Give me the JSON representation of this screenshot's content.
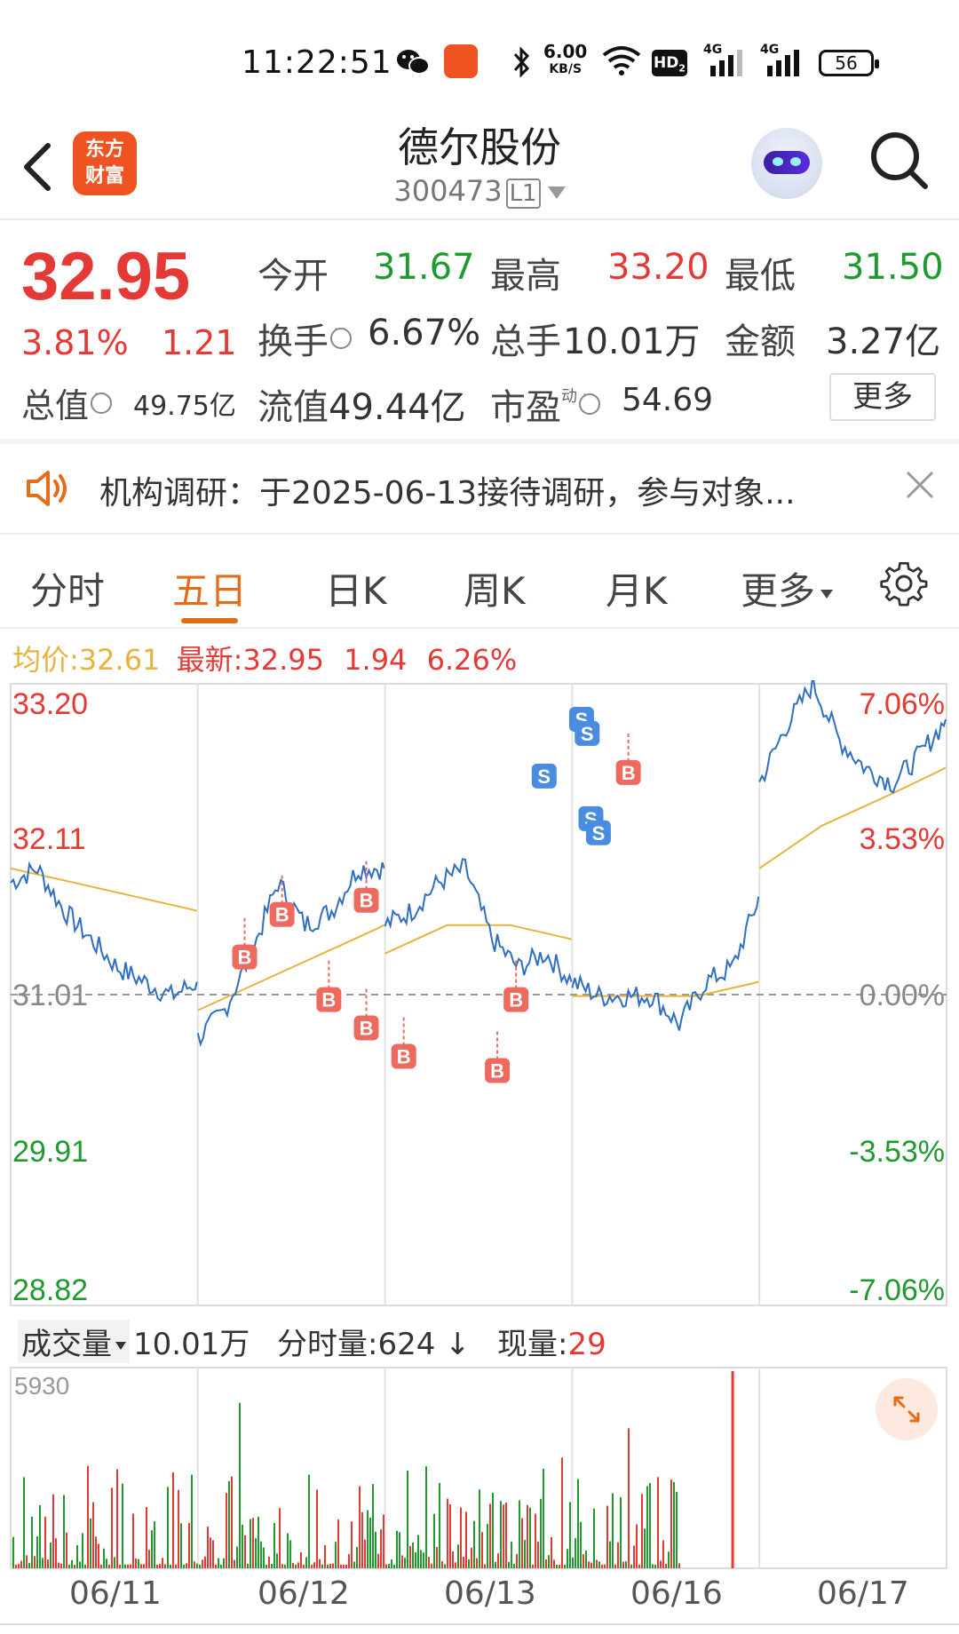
{
  "status_bar": {
    "time": "11:22:51",
    "net_speed": "6.00",
    "net_unit": "KB/S",
    "hd": "HD",
    "hd_sub": "2",
    "sig1": "4G",
    "sig2": "4G",
    "battery": "56",
    "icons": [
      "wechat-icon",
      "app-notify-icon",
      "bluetooth-icon",
      "wifi-icon",
      "signal-icon"
    ]
  },
  "header": {
    "logo_line1": "东方",
    "logo_line2": "财富",
    "name": "德尔股份",
    "code": "300473",
    "code_badge": "L1"
  },
  "quote": {
    "price": "32.95",
    "change_pct": "3.81%",
    "change_val": "1.21",
    "open_label": "今开",
    "open": "31.67",
    "high_label": "最高",
    "high": "33.20",
    "low_label": "最低",
    "low": "31.50",
    "turnover_label": "换手",
    "turnover": "6.67%",
    "volume_label": "总手",
    "volume": "10.01万",
    "amount_label": "金额",
    "amount": "3.27亿",
    "mktcap_label": "总值",
    "mktcap": "49.75亿",
    "float_label": "流值",
    "float": "49.44亿",
    "pe_label": "市盈",
    "pe_sup": "动",
    "pe": "54.69",
    "more_label": "更多"
  },
  "notice": {
    "text": "机构调研：于2025-06-13接待调研，参与对象..."
  },
  "tabs": {
    "items": [
      "分时",
      "五日",
      "日K",
      "周K",
      "月K",
      "更多"
    ],
    "active": "五日"
  },
  "legend": {
    "avg_label": "均价:",
    "avg_value": "32.61",
    "latest_label": "最新:",
    "latest_value": "32.95",
    "latest_change": "1.94",
    "latest_pct": "6.26%"
  },
  "volume_bar": {
    "label": "成交量",
    "total": "10.01万",
    "minute_label": "分时量:624",
    "current_label": "现量:",
    "current_value": "29"
  },
  "chart_data": {
    "type": "line",
    "y_ticks_left": [
      "33.20",
      "32.11",
      "31.01",
      "29.91",
      "28.82"
    ],
    "y_ticks_right": [
      "7.06%",
      "3.53%",
      "0.00%",
      "-3.53%",
      "-7.06%"
    ],
    "ylim": [
      28.82,
      33.2
    ],
    "base_price": 31.01,
    "days": [
      "06/11",
      "06/12",
      "06/13",
      "06/16",
      "06/17"
    ],
    "price_keypoints": [
      {
        "day": 0,
        "points": [
          31.8,
          31.9,
          31.6,
          31.4,
          31.2,
          31.1,
          31.0,
          31.1
        ]
      },
      {
        "day": 1,
        "points": [
          30.7,
          30.9,
          31.3,
          31.8,
          31.5,
          31.6,
          31.9,
          31.9
        ]
      },
      {
        "day": 2,
        "points": [
          31.5,
          31.6,
          31.8,
          31.9,
          31.4,
          31.2,
          31.3,
          31.1
        ]
      },
      {
        "day": 3,
        "points": [
          31.1,
          31.0,
          31.0,
          31.0,
          30.8,
          31.1,
          31.2,
          31.7
        ]
      },
      {
        "day": 4,
        "points": [
          32.5,
          32.9,
          33.2,
          32.8,
          32.6,
          32.5,
          32.7,
          32.95
        ]
      }
    ],
    "avg_keypoints": [
      {
        "day": 0,
        "points": [
          31.9,
          31.8,
          31.7,
          31.6
        ]
      },
      {
        "day": 1,
        "points": [
          30.9,
          31.1,
          31.3,
          31.5
        ]
      },
      {
        "day": 2,
        "points": [
          31.3,
          31.5,
          31.5,
          31.4
        ]
      },
      {
        "day": 3,
        "points": [
          31.0,
          31.0,
          31.0,
          31.1
        ]
      },
      {
        "day": 4,
        "points": [
          31.9,
          32.2,
          32.4,
          32.61
        ]
      }
    ],
    "volume_max_label": "5930",
    "volume_max": 5930,
    "trade_markers": {
      "buy_label": "B",
      "sell_label": "S"
    }
  },
  "colors": {
    "up": "#e53935",
    "down": "#1f9a2e",
    "accent": "#e46d1a",
    "price_line": "#2e6fc2",
    "avg_line": "#e8b33c",
    "buy_marker": "#ee6a5f",
    "sell_marker": "#4a8ce0"
  }
}
